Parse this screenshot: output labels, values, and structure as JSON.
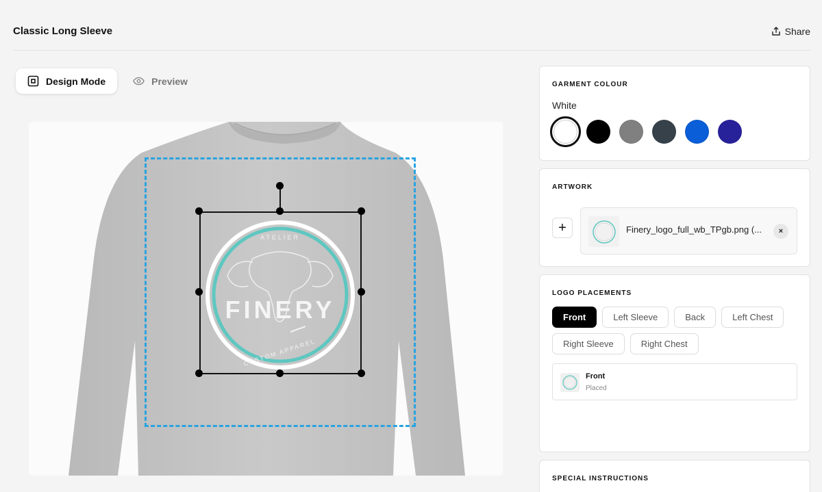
{
  "header": {
    "title": "Classic Long Sleeve",
    "share_label": "Share"
  },
  "mode_tabs": [
    {
      "label": "Design Mode",
      "active": true,
      "icon": "design-mode-icon"
    },
    {
      "label": "Preview",
      "active": false,
      "icon": "eye-icon"
    }
  ],
  "canvas": {
    "garment": "long-sleeve-tshirt",
    "garment_color": "#c5c5c5",
    "print_area_color": "#29a3e1",
    "logo": {
      "top_text": "ATELIER",
      "main_text": "FINERY",
      "bottom_text": "CUSTOM APPAREL",
      "ring_color": "#5ec7c0"
    }
  },
  "garment_colour": {
    "title": "GARMENT COLOUR",
    "selected_name": "White",
    "swatches": [
      {
        "name": "White",
        "hex": "#ffffff",
        "selected": true
      },
      {
        "name": "Black",
        "hex": "#000000",
        "selected": false
      },
      {
        "name": "Grey",
        "hex": "#808080",
        "selected": false
      },
      {
        "name": "Charcoal",
        "hex": "#37414a",
        "selected": false
      },
      {
        "name": "Royal Blue",
        "hex": "#0a5ed8",
        "selected": false
      },
      {
        "name": "Indigo",
        "hex": "#27219a",
        "selected": false
      }
    ]
  },
  "artwork": {
    "title": "ARTWORK",
    "add_label": "+",
    "file_name": "Finery_logo_full_wb_TPgb.png (...",
    "remove_label": "×"
  },
  "logo_placements": {
    "title": "LOGO PLACEMENTS",
    "options": [
      {
        "label": "Front",
        "active": true
      },
      {
        "label": "Left Sleeve",
        "active": false
      },
      {
        "label": "Back",
        "active": false
      },
      {
        "label": "Left Chest",
        "active": false
      },
      {
        "label": "Right Sleeve",
        "active": false
      },
      {
        "label": "Right Chest",
        "active": false
      }
    ],
    "placed": {
      "name": "Front",
      "status": "Placed"
    }
  },
  "special_instructions": {
    "title": "SPECIAL INSTRUCTIONS"
  }
}
